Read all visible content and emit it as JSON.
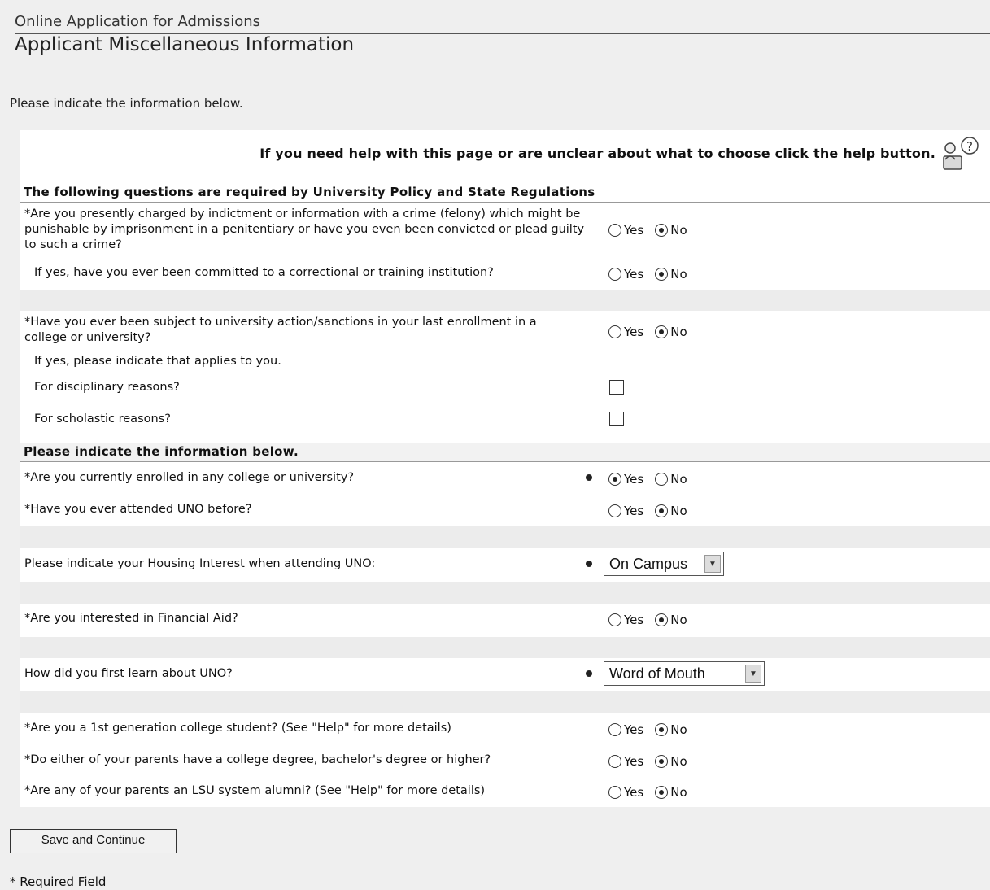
{
  "header": {
    "breadcrumb": "Online Application for Admissions",
    "title": "Applicant Miscellaneous Information",
    "intro": "Please indicate the information below."
  },
  "help": {
    "text": "If you need help with this page or are unclear about what to choose click the help button.",
    "icon": "help-icon"
  },
  "section_policy": {
    "heading": "The following questions are required by University Policy and State Regulations",
    "q_felony": "*Are you presently charged by indictment or information with a crime (felony) which might be punishable by imprisonment in a penitentiary or have you even been convicted or plead guilty to such a crime?",
    "q_felony_value": "No",
    "q_committed": "If yes, have you ever been committed to a correctional or training institution?",
    "q_committed_value": "No",
    "q_sanctions": "*Have you ever been subject to university action/sanctions in your last enrollment in a college or university?",
    "q_sanctions_value": "No",
    "sanctions_subhead": "If yes, please indicate that applies to you.",
    "disciplinary_label": "For disciplinary reasons?",
    "disciplinary_checked": false,
    "scholastic_label": "For scholastic reasons?",
    "scholastic_checked": false
  },
  "section_info": {
    "heading": "Please indicate the information below.",
    "q_enrolled": "*Are you currently enrolled in any college or university?",
    "q_enrolled_value": "Yes",
    "q_attended": "*Have you ever attended UNO before?",
    "q_attended_value": "No",
    "q_housing": "Please indicate your Housing Interest when attending UNO:",
    "housing_selected": "On Campus",
    "q_financial_aid": "*Are you interested in Financial Aid?",
    "q_financial_aid_value": "No",
    "q_learn": "How did you first learn about UNO?",
    "learn_selected": "Word of Mouth",
    "q_first_gen": "*Are you a 1st generation college student? (See \"Help\" for more details)",
    "q_first_gen_value": "No",
    "q_parents_degree": "*Do either of your parents have a college degree, bachelor's degree or higher?",
    "q_parents_degree_value": "No",
    "q_lsu_alumni": "*Are any of your parents an LSU system alumni? (See \"Help\" for more details)",
    "q_lsu_alumni_value": "No"
  },
  "labels": {
    "yes": "Yes",
    "no": "No"
  },
  "footer": {
    "save_label": "Save and Continue",
    "required_note": "* Required Field"
  }
}
